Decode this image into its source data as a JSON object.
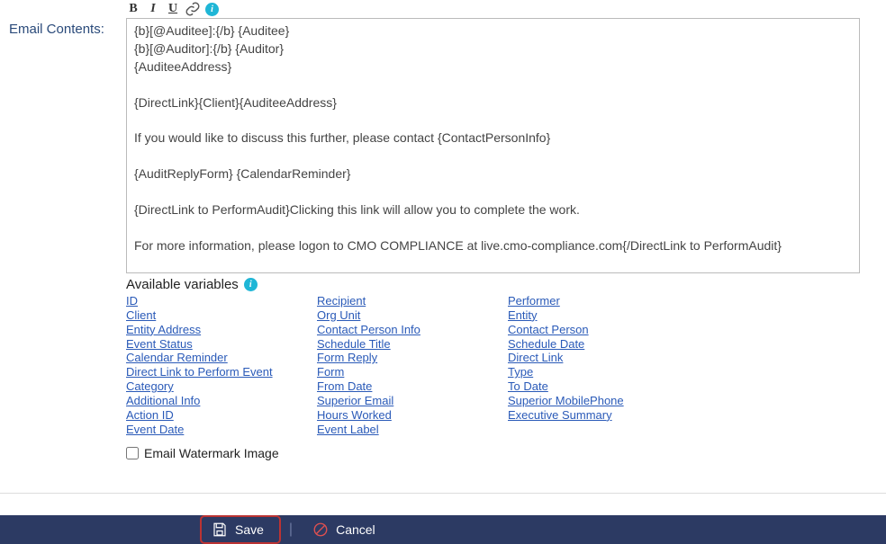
{
  "labels": {
    "emailContents": "Email Contents:",
    "availableVariables": "Available variables",
    "watermark": "Email Watermark Image",
    "save": "Save",
    "cancel": "Cancel"
  },
  "toolbar": {
    "bold": "B",
    "italic": "I",
    "underline": "U"
  },
  "editorText": "{b}[@Auditee]:{/b} {Auditee}\n{b}[@Auditor]:{/b} {Auditor}\n{AuditeeAddress}\n\n{DirectLink}{Client}{AuditeeAddress}\n\nIf you would like to discuss this further, please contact {ContactPersonInfo}\n\n{AuditReplyForm} {CalendarReminder}\n\n{DirectLink to PerformAudit}Clicking this link will allow you to complete the work.\n\nFor more information, please logon to CMO COMPLIANCE at live.cmo-compliance.com{/DirectLink to PerformAudit}",
  "variables": {
    "col1": [
      "ID",
      "Client",
      "Entity Address",
      "Event Status",
      "Calendar Reminder",
      "Direct Link to Perform Event",
      "Category",
      "Additional Info",
      "Action ID",
      "Event Date"
    ],
    "col2": [
      "Recipient",
      "Org Unit",
      "Contact Person Info",
      "Schedule Title",
      "Form Reply",
      "Form",
      "From Date",
      "Superior Email",
      "Hours Worked",
      "Event Label"
    ],
    "col3": [
      "Performer",
      "Entity",
      "Contact Person",
      "Schedule Date",
      "Direct Link",
      "Type",
      "To Date",
      "Superior MobilePhone",
      "Executive Summary"
    ]
  }
}
